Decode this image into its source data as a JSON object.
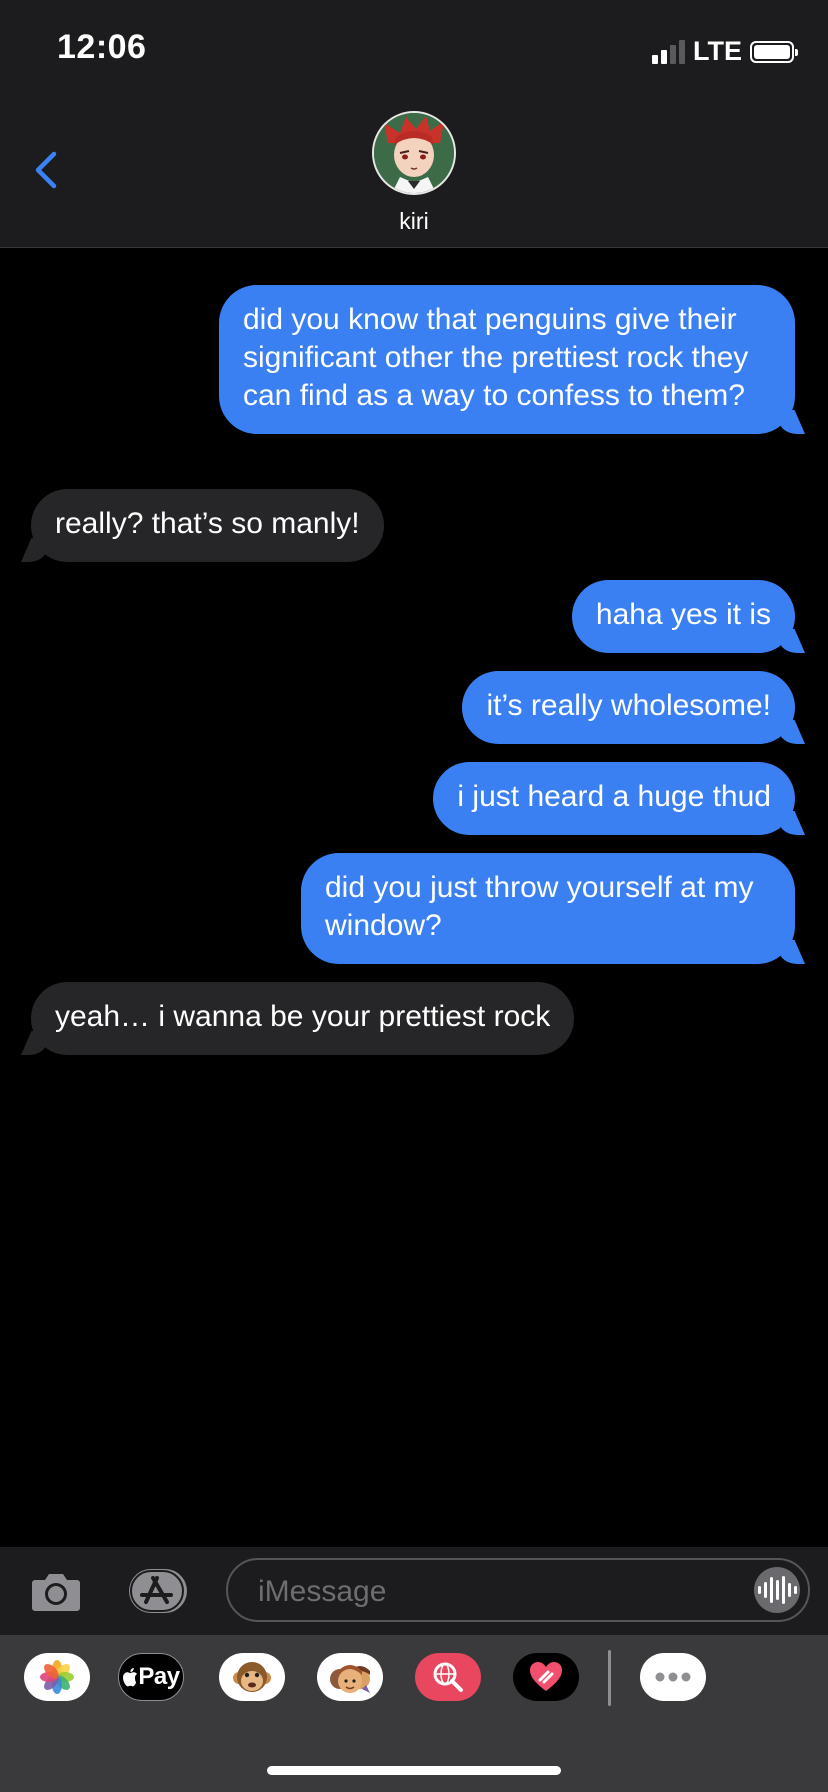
{
  "status_bar": {
    "time": "12:06",
    "network": "LTE",
    "signal_bars_filled": 2,
    "signal_bars_total": 4,
    "battery_level": 1.0
  },
  "header": {
    "contact_name": "kiri",
    "avatar_icon": "contact-avatar",
    "back_icon": "chevron-left-icon"
  },
  "messages": [
    {
      "direction": "outgoing",
      "text": "did you know that penguins give their significant other the prettiest rock they can find as a way to confess to them?"
    },
    {
      "direction": "incoming",
      "text": "really? that’s so manly!"
    },
    {
      "direction": "outgoing",
      "text": "haha yes it is"
    },
    {
      "direction": "outgoing",
      "text": "it’s really wholesome!"
    },
    {
      "direction": "outgoing",
      "text": "i just heard a huge thud"
    },
    {
      "direction": "outgoing",
      "text": "did you just throw yourself at my window?"
    },
    {
      "direction": "incoming",
      "text": "yeah… i wanna be your prettiest rock"
    }
  ],
  "input_bar": {
    "placeholder": "iMessage",
    "camera_icon": "camera-icon",
    "appstore_icon": "app-store-icon",
    "audio_icon": "audio-waveform-icon"
  },
  "app_drawer": {
    "apps": [
      {
        "name": "photos-app-icon"
      },
      {
        "name": "apple-pay-app-icon",
        "label": "Pay"
      },
      {
        "name": "animoji-app-icon"
      },
      {
        "name": "memoji-app-icon"
      },
      {
        "name": "web-search-app-icon"
      },
      {
        "name": "digital-touch-app-icon"
      },
      {
        "name": "more-apps-icon"
      }
    ]
  },
  "colors": {
    "outgoing_bubble": "#3b80f3",
    "incoming_bubble": "#262628",
    "accent": "#3b82f6",
    "background": "#000000"
  }
}
